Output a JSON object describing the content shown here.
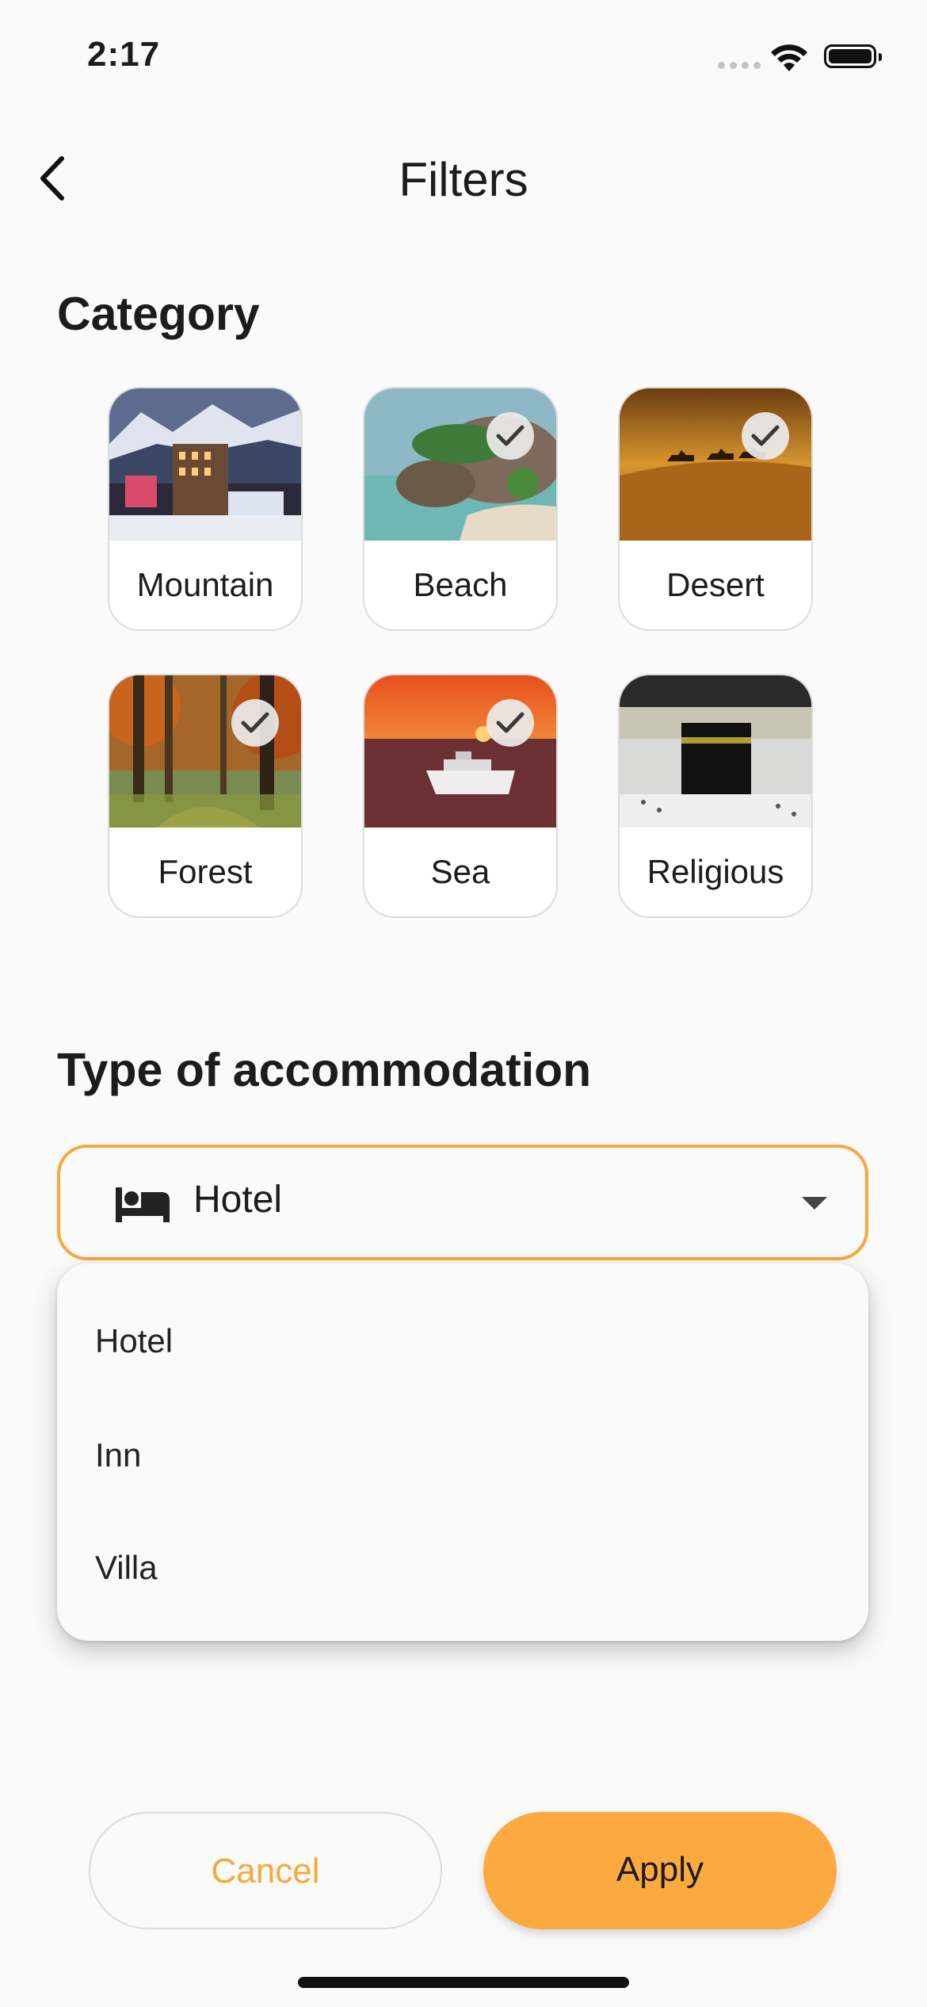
{
  "status_bar": {
    "time": "2:17"
  },
  "header": {
    "title": "Filters",
    "back_icon": "chevron-left-icon"
  },
  "category": {
    "title": "Category",
    "items": [
      {
        "label": "Mountain",
        "selected": false
      },
      {
        "label": "Beach",
        "selected": true
      },
      {
        "label": "Desert",
        "selected": true
      },
      {
        "label": "Forest",
        "selected": true
      },
      {
        "label": "Sea",
        "selected": true
      },
      {
        "label": "Religious",
        "selected": false
      }
    ]
  },
  "accommodation": {
    "title": "Type of accommodation",
    "selected_value": "Hotel",
    "icon": "bed-icon",
    "options": [
      "Hotel",
      "Inn",
      "Villa"
    ]
  },
  "actions": {
    "cancel_label": "Cancel",
    "apply_label": "Apply"
  },
  "colors": {
    "accent": "#F8A73B",
    "apply_bg": "#FCA93F",
    "card_border": "#DCDCDC"
  }
}
